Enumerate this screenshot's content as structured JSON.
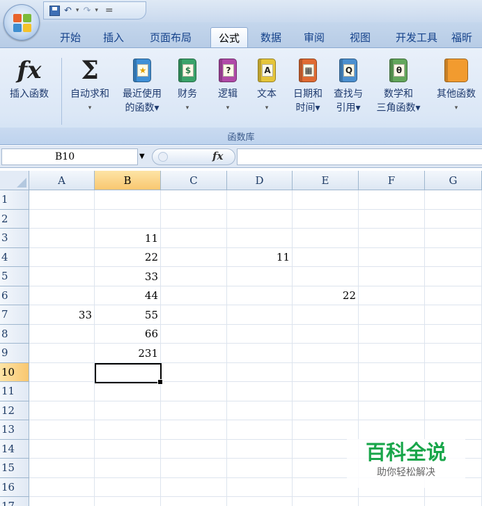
{
  "quick_access": {
    "separator_glyph": "="
  },
  "tabs": [
    {
      "label": "开始",
      "active": false
    },
    {
      "label": "插入",
      "active": false
    },
    {
      "label": "页面布局",
      "active": false
    },
    {
      "label": "公式",
      "active": true
    },
    {
      "label": "数据",
      "active": false
    },
    {
      "label": "审阅",
      "active": false
    },
    {
      "label": "视图",
      "active": false
    },
    {
      "label": "开发工具",
      "active": false
    },
    {
      "label": "福昕",
      "active": false
    }
  ],
  "ribbon": {
    "buttons": [
      {
        "line1": "插入函数",
        "line2": "",
        "icon": "fx-icon"
      },
      {
        "line1": "自动求和",
        "line2": "▾",
        "icon": "sigma-icon"
      },
      {
        "line1": "最近使用",
        "line2": "的函数▾",
        "icon": "recent-functions-book-icon"
      },
      {
        "line1": "财务",
        "line2": "▾",
        "icon": "financial-book-icon"
      },
      {
        "line1": "逻辑",
        "line2": "▾",
        "icon": "logical-book-icon"
      },
      {
        "line1": "文本",
        "line2": "▾",
        "icon": "text-book-icon"
      },
      {
        "line1": "日期和",
        "line2": "时间▾",
        "icon": "date-time-book-icon"
      },
      {
        "line1": "查找与",
        "line2": "引用▾",
        "icon": "lookup-reference-book-icon"
      },
      {
        "line1": "数学和",
        "line2": "三角函数▾",
        "icon": "math-trig-book-icon"
      },
      {
        "line1": "其他函数",
        "line2": "▾",
        "icon": "more-functions-book-icon"
      }
    ],
    "group_label": "函数库",
    "colors": {
      "recent": "#3f8fd6",
      "financial": "#3aa36a",
      "logical": "#b04aa8",
      "text": "#e5c53a",
      "datetime": "#e06a32",
      "lookup": "#4b8fcf",
      "math": "#62a65b",
      "more": "#f29b2f"
    },
    "glyphs": {
      "fx": "fx",
      "sigma": "Σ",
      "recent": "★",
      "financial": "$",
      "logical": "?",
      "text": "A",
      "datetime": "▦",
      "lookup": "Q",
      "math": "θ",
      "more": ""
    }
  },
  "formula_bar": {
    "name_box": "B10",
    "fx_label": "fx",
    "content": ""
  },
  "sheet": {
    "columns": [
      "A",
      "B",
      "C",
      "D",
      "E",
      "F",
      "G"
    ],
    "selected_column": "B",
    "rows": [
      "1",
      "2",
      "3",
      "4",
      "5",
      "6",
      "7",
      "8",
      "9",
      "10",
      "11",
      "12",
      "13",
      "14",
      "15",
      "16",
      "17"
    ],
    "selected_row": "10",
    "cells": {
      "B3": "11",
      "B4": "22",
      "B5": "33",
      "B6": "44",
      "B7": "55",
      "B8": "66",
      "B9": "231",
      "D4": "11",
      "E6": "22",
      "A7": "33"
    }
  },
  "watermark": {
    "title": "百科全说",
    "subtitle": "助你轻松解决"
  }
}
